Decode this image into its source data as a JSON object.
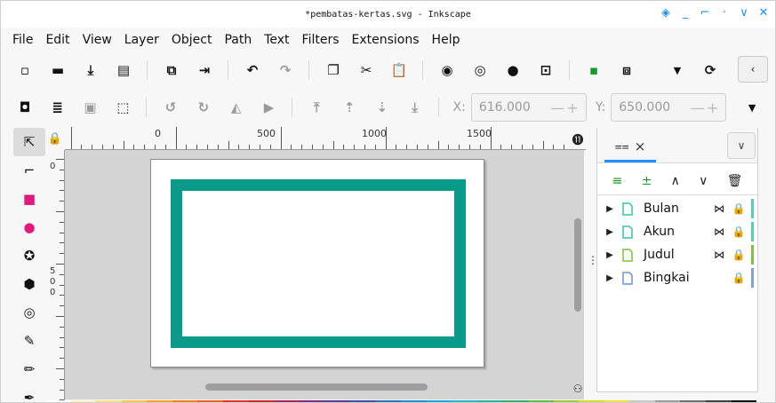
{
  "window": {
    "title": "*pembatas-kertas.svg - Inkscape",
    "controls": [
      "◈",
      "_",
      "⌐",
      "·",
      "∨",
      "✕"
    ]
  },
  "menu": [
    "File",
    "Edit",
    "View",
    "Layer",
    "Object",
    "Path",
    "Text",
    "Filters",
    "Extensions",
    "Help"
  ],
  "toolbar_commands": [
    {
      "icon": "new-document-icon",
      "glyph": "▫"
    },
    {
      "icon": "open-icon",
      "glyph": "▬"
    },
    {
      "icon": "save-icon",
      "glyph": "⤓"
    },
    {
      "icon": "print-icon",
      "glyph": "▤"
    },
    {
      "icon": "import-icon",
      "glyph": "⧉"
    },
    {
      "icon": "export-icon",
      "glyph": "⇥"
    },
    {
      "icon": "undo-icon",
      "glyph": "↶"
    },
    {
      "icon": "redo-icon",
      "glyph": "↷"
    },
    {
      "icon": "copy-icon",
      "glyph": "❐"
    },
    {
      "icon": "cut-icon",
      "glyph": "✂"
    },
    {
      "icon": "paste-icon",
      "glyph": "📋"
    },
    {
      "icon": "zoom-selection-icon",
      "glyph": "◉"
    },
    {
      "icon": "zoom-drawing-icon",
      "glyph": "◎"
    },
    {
      "icon": "zoom-page-icon",
      "glyph": "●"
    },
    {
      "icon": "zoom-center-icon",
      "glyph": "⊡"
    },
    {
      "icon": "duplicate-icon",
      "glyph": "▪"
    },
    {
      "icon": "clone-icon",
      "glyph": "⧈"
    },
    {
      "icon": "dropdown-icon",
      "glyph": "▼"
    },
    {
      "icon": "group-icon",
      "glyph": "⟳"
    }
  ],
  "nav_button": "‹",
  "toolbar_select": [
    {
      "icon": "select-all-icon",
      "glyph": "◘",
      "dim": false
    },
    {
      "icon": "select-all-layers-icon",
      "glyph": "≣",
      "dim": false
    },
    {
      "icon": "deselect-icon",
      "glyph": "▣",
      "dim": true
    },
    {
      "icon": "select-same-icon",
      "glyph": "⬚",
      "dim": false
    },
    {
      "icon": "rotate-ccw-icon",
      "glyph": "↺",
      "dim": true
    },
    {
      "icon": "rotate-cw-icon",
      "glyph": "↻",
      "dim": true
    },
    {
      "icon": "flip-horizontal-icon",
      "glyph": "◭",
      "dim": true
    },
    {
      "icon": "flip-vertical-icon",
      "glyph": "▶",
      "dim": true
    },
    {
      "icon": "raise-top-icon",
      "glyph": "⤒",
      "dim": true
    },
    {
      "icon": "raise-icon",
      "glyph": "⇡",
      "dim": true
    },
    {
      "icon": "lower-icon",
      "glyph": "⇣",
      "dim": true
    },
    {
      "icon": "lower-bottom-icon",
      "glyph": "⤓",
      "dim": true
    }
  ],
  "coords": {
    "x_label": "X:",
    "x_value": "616.000",
    "y_label": "Y:",
    "y_value": "650.000",
    "stepper": "—+"
  },
  "more_dropdown": "▼",
  "tools": [
    {
      "icon": "selector-tool-icon",
      "glyph": "⇱",
      "active": true
    },
    {
      "icon": "node-tool-icon",
      "glyph": "⌐",
      "active": false
    },
    {
      "icon": "rectangle-tool-icon",
      "glyph": "■",
      "active": false,
      "color": "#e0197d"
    },
    {
      "icon": "ellipse-tool-icon",
      "glyph": "●",
      "active": false,
      "color": "#e0197d"
    },
    {
      "icon": "star-tool-icon",
      "glyph": "✪",
      "active": false
    },
    {
      "icon": "3d-box-tool-icon",
      "glyph": "⬢",
      "active": false
    },
    {
      "icon": "spiral-tool-icon",
      "glyph": "◎",
      "active": false
    },
    {
      "icon": "pen-tool-icon",
      "glyph": "✎",
      "active": false
    },
    {
      "icon": "pencil-tool-icon",
      "glyph": "✏",
      "active": false
    },
    {
      "icon": "calligraphy-tool-icon",
      "glyph": "✒",
      "active": false
    }
  ],
  "ruler": {
    "top_labels": [
      "0",
      "500",
      "1000",
      "1500"
    ],
    "left_labels": [
      "0",
      "5",
      "0",
      "0"
    ]
  },
  "canvas": {
    "border_color": "#0a9a8a"
  },
  "layers_panel": {
    "tab_icon": "layers-icon",
    "tab_close": "×",
    "menu_chevron": "∨",
    "actions": [
      {
        "icon": "add-layer-icon",
        "glyph": "≡"
      },
      {
        "icon": "add-sublayer-icon",
        "glyph": "±"
      },
      {
        "icon": "raise-layer-icon",
        "glyph": "∧"
      },
      {
        "icon": "lower-layer-icon",
        "glyph": "∨"
      },
      {
        "icon": "delete-layer-icon",
        "glyph": "🗑"
      }
    ],
    "layers": [
      {
        "name": "Bulan",
        "hidden": true,
        "locked": true,
        "color": "#4fd1b2",
        "doc_color": "#3cc2a4"
      },
      {
        "name": "Akun",
        "hidden": true,
        "locked": true,
        "color": "#4fd1b2",
        "doc_color": "#3cc2a4"
      },
      {
        "name": "Judul",
        "hidden": true,
        "locked": true,
        "color": "#7ec043",
        "doc_color": "#7ec043"
      },
      {
        "name": "Bingkai",
        "hidden": false,
        "locked": true,
        "color": "#7fa4d8",
        "doc_color": "#6e93cf"
      }
    ]
  },
  "palette": [
    "#ffffff",
    "#fdf1c8",
    "#fde08a",
    "#fbc54a",
    "#f8a227",
    "#f28021",
    "#ee5f24",
    "#e2342a",
    "#c8272f",
    "#a5275b",
    "#7b2d7b",
    "#5b3a8f",
    "#3f4fa3",
    "#2e6fb7",
    "#1f8ed0",
    "#21a6d8",
    "#2ab6c1",
    "#2bb39a",
    "#3cab6c",
    "#69b94a",
    "#a1c93b",
    "#d6d730",
    "#f0e047",
    "#c9c9c9",
    "#9c9c9c",
    "#6e6e6e",
    "#404040",
    "#111111"
  ]
}
